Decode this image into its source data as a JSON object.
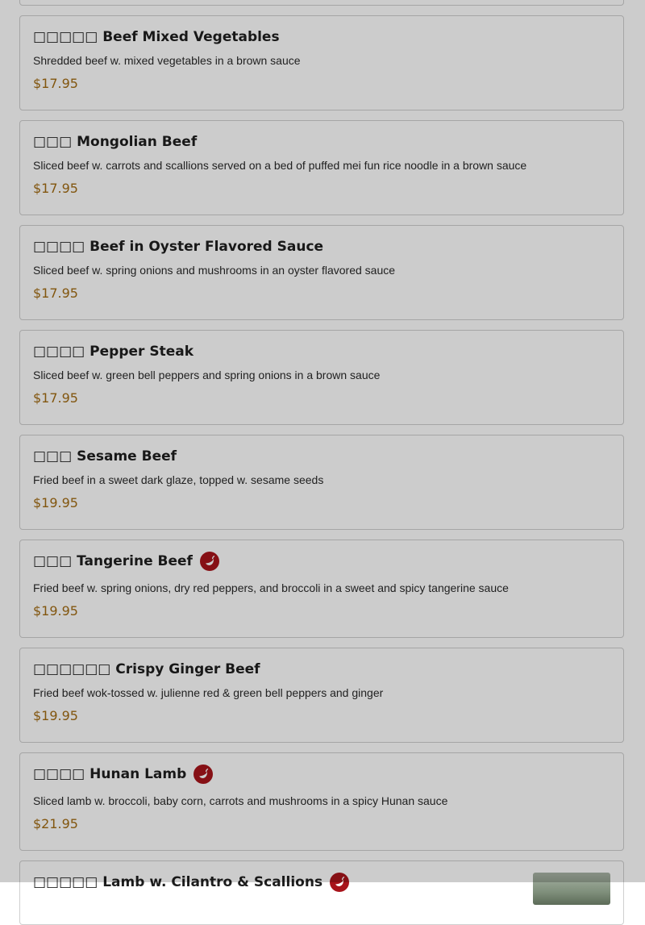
{
  "colors": {
    "price": "#a36c13",
    "chili": "#a8141b",
    "overlay": "rgba(0,0,0,0.2)"
  },
  "items": [
    {
      "name": "□□□□□ Beef Mixed Vegetables",
      "description": "Shredded beef w. mixed vegetables in a brown sauce",
      "price": "$17.95",
      "spicy": false
    },
    {
      "name": "□□□ Mongolian Beef",
      "description": "Sliced beef w. carrots and scallions served on a bed of puffed mei fun rice noodle in a brown sauce",
      "price": "$17.95",
      "spicy": false
    },
    {
      "name": "□□□□ Beef in Oyster Flavored Sauce",
      "description": "Sliced beef w. spring onions and mushrooms in an oyster flavored sauce",
      "price": "$17.95",
      "spicy": false
    },
    {
      "name": "□□□□ Pepper Steak",
      "description": "Sliced beef w. green bell peppers and spring onions in a brown sauce",
      "price": "$17.95",
      "spicy": false
    },
    {
      "name": "□□□ Sesame Beef",
      "description": "Fried beef in a sweet dark glaze, topped w. sesame seeds",
      "price": "$19.95",
      "spicy": false
    },
    {
      "name": "□□□ Tangerine Beef",
      "description": "Fried beef w. spring onions, dry red peppers, and broccoli in a sweet and spicy tangerine sauce",
      "price": "$19.95",
      "spicy": true
    },
    {
      "name": "□□□□□□ Crispy Ginger Beef",
      "description": "Fried beef wok-tossed w. julienne red & green bell peppers and ginger",
      "price": "$19.95",
      "spicy": false
    },
    {
      "name": "□□□□ Hunan Lamb",
      "description": "Sliced lamb w. broccoli, baby corn, carrots and mushrooms in a spicy Hunan sauce",
      "price": "$21.95",
      "spicy": true
    }
  ],
  "partial_item": {
    "name": "□□□□□ Lamb w. Cilantro & Scallions",
    "spicy": true,
    "has_image": true
  }
}
